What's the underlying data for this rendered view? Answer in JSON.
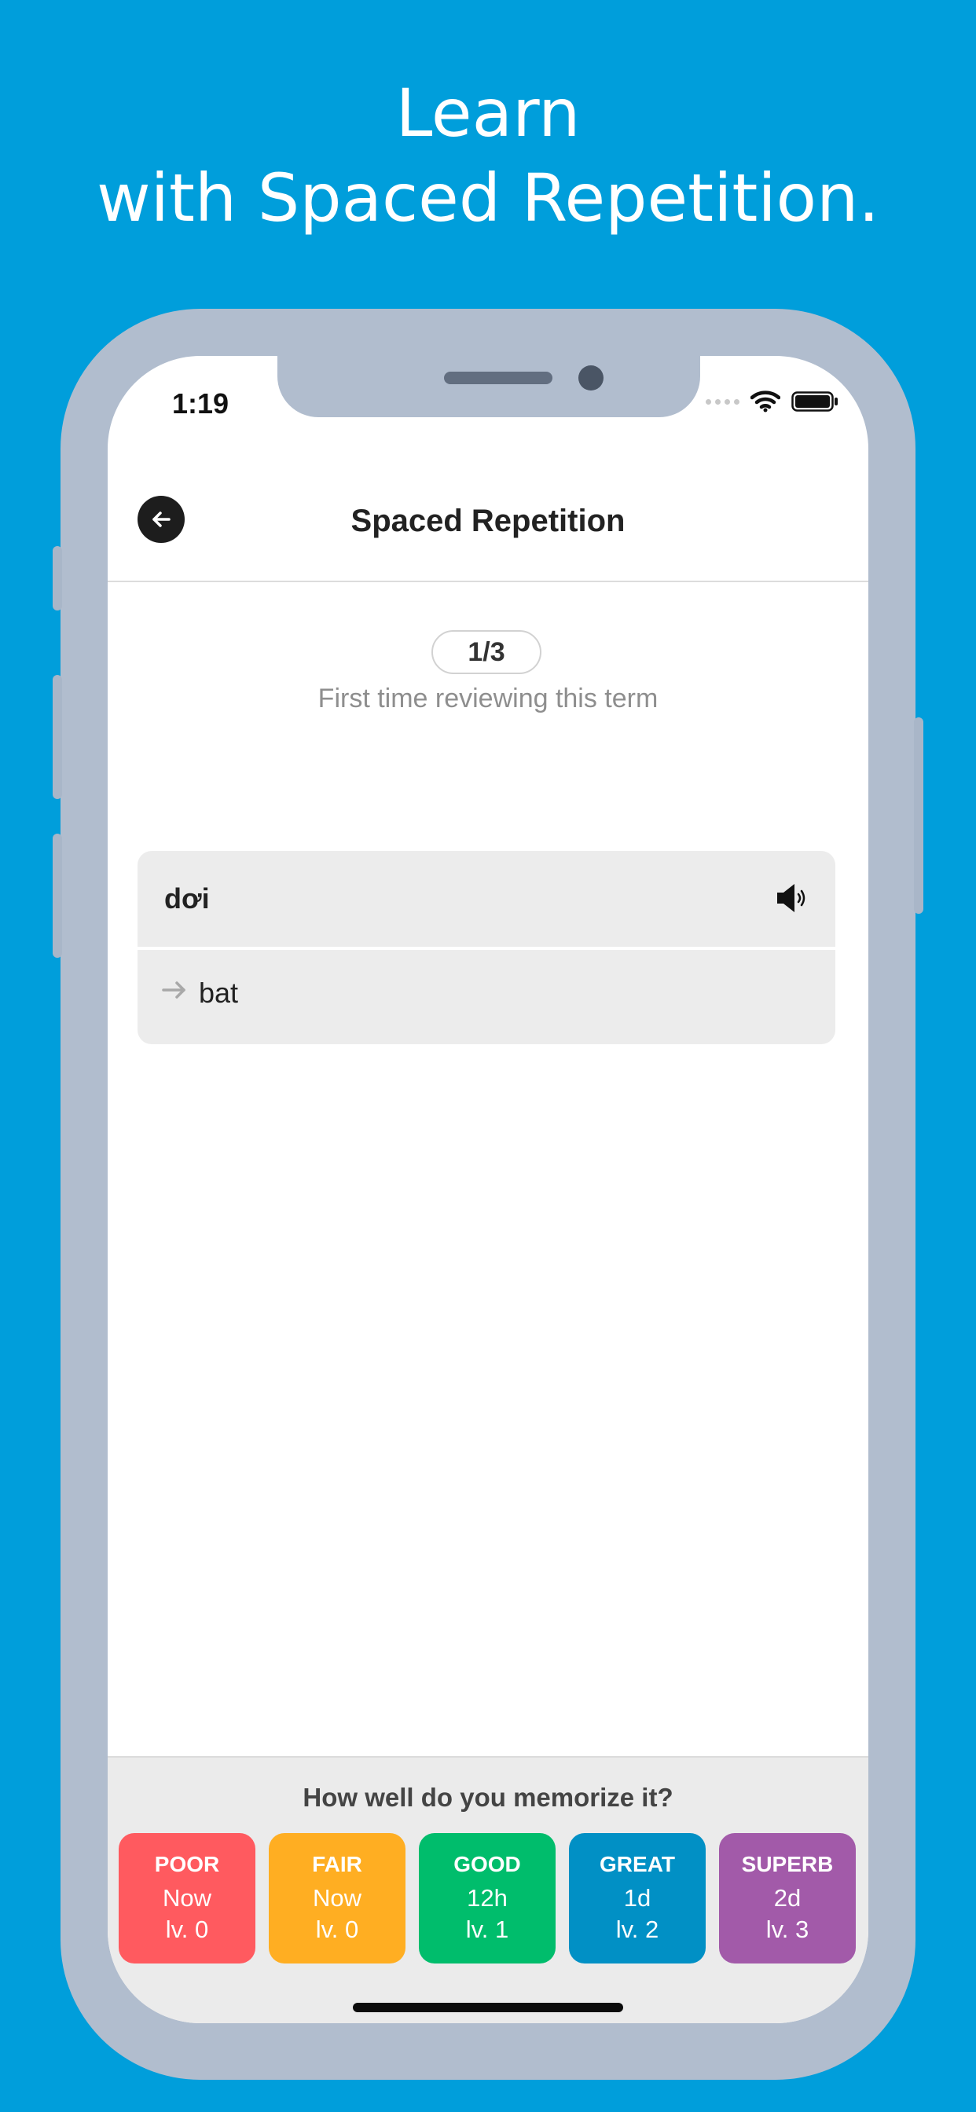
{
  "headline": {
    "line1": "Learn",
    "line2": "with Spaced Repetition."
  },
  "status": {
    "time": "1:19"
  },
  "nav": {
    "title": "Spaced Repetition",
    "back_icon": "back-arrow-icon"
  },
  "progress": {
    "counter": "1/3",
    "note": "First time reviewing this term"
  },
  "card": {
    "term": "dơi",
    "definition": "bat",
    "audio_icon": "speaker-icon",
    "arrow_icon": "arrow-right-icon"
  },
  "rating": {
    "question": "How well do you memorize it?",
    "options": [
      {
        "label": "POOR",
        "time": "Now",
        "level": "lv. 0",
        "color": "#ff5a5f"
      },
      {
        "label": "FAIR",
        "time": "Now",
        "level": "lv. 0",
        "color": "#ffae22"
      },
      {
        "label": "GOOD",
        "time": "12h",
        "level": "lv. 1",
        "color": "#00bd6c"
      },
      {
        "label": "GREAT",
        "time": "1d",
        "level": "lv. 2",
        "color": "#0190c5"
      },
      {
        "label": "SUPERB",
        "time": "2d",
        "level": "lv. 3",
        "color": "#a25aa9"
      }
    ]
  },
  "colors": {
    "background": "#009edb",
    "phone_frame": "#b1bdce"
  }
}
